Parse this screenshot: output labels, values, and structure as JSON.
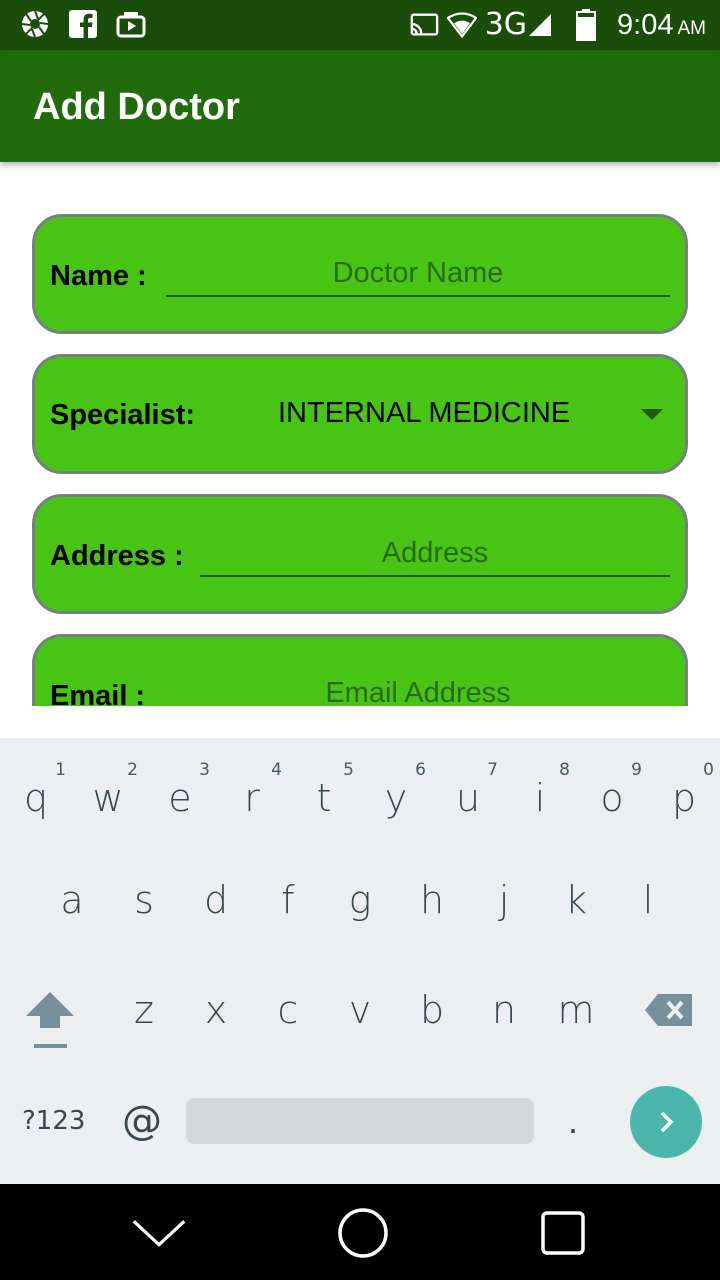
{
  "status_bar": {
    "left_icons": [
      "aperture-icon",
      "facebook-icon",
      "media-icon"
    ],
    "right_icons": [
      "cast-icon",
      "wifi-icon"
    ],
    "network": "3G",
    "time": "9:04",
    "ampm": "AM"
  },
  "app_bar": {
    "title": "Add Doctor"
  },
  "form": {
    "name": {
      "label": "Name :",
      "placeholder": "Doctor Name"
    },
    "specialist": {
      "label": "Specialist:",
      "value": "INTERNAL MEDICINE"
    },
    "address": {
      "label": "Address :",
      "placeholder": "Address"
    },
    "email": {
      "label": "Email :",
      "placeholder": "Email Address"
    }
  },
  "keyboard": {
    "row1": [
      {
        "char": "q",
        "hint": "1"
      },
      {
        "char": "w",
        "hint": "2"
      },
      {
        "char": "e",
        "hint": "3"
      },
      {
        "char": "r",
        "hint": "4"
      },
      {
        "char": "t",
        "hint": "5"
      },
      {
        "char": "y",
        "hint": "6"
      },
      {
        "char": "u",
        "hint": "7"
      },
      {
        "char": "i",
        "hint": "8"
      },
      {
        "char": "o",
        "hint": "9"
      },
      {
        "char": "p",
        "hint": "0"
      }
    ],
    "row2": [
      "a",
      "s",
      "d",
      "f",
      "g",
      "h",
      "j",
      "k",
      "l"
    ],
    "row3": [
      "z",
      "x",
      "c",
      "v",
      "b",
      "n",
      "m"
    ],
    "symbols_label": "?123",
    "at_label": "@",
    "period_label": ".",
    "accent_color": "#4db6ac"
  },
  "colors": {
    "status_bar": "#1a4d0a",
    "app_bar": "#226b0c",
    "card_fill": "#47c414",
    "card_border": "#767f83"
  }
}
